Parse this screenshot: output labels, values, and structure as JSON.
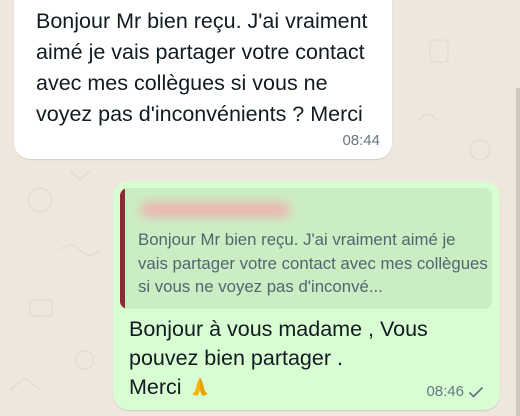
{
  "incoming": {
    "text": "Bonjour Mr bien reçu. J'ai vraiment aimé je vais partager votre contact avec mes collègues si vous ne voyez pas d'inconvénients ? Merci",
    "time": "08:44"
  },
  "outgoing": {
    "quote": {
      "text": "Bonjour Mr bien reçu. J'ai vraiment aimé je vais partager votre contact avec mes collègues si vous ne voyez pas d'inconvé..."
    },
    "text_line1": "Bonjour à vous madame ,   Vous",
    "text_line2": "pouvez bien partager .",
    "text_line3": "Merci",
    "emoji_icon": "folded-hands-icon",
    "time": "08:46",
    "status_icon": "single-check-icon"
  },
  "colors": {
    "background": "#efe7dd",
    "incoming_bubble": "#ffffff",
    "outgoing_bubble": "#d9fdd3",
    "quote_bar": "#8b2b33"
  }
}
